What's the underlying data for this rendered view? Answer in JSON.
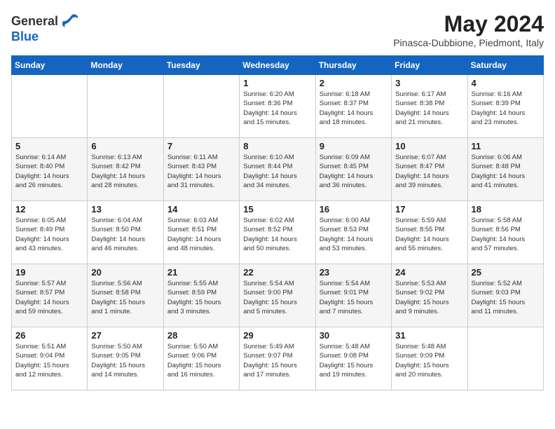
{
  "logo": {
    "general": "General",
    "blue": "Blue"
  },
  "title": "May 2024",
  "subtitle": "Pinasca-Dubbione, Piedmont, Italy",
  "days_of_week": [
    "Sunday",
    "Monday",
    "Tuesday",
    "Wednesday",
    "Thursday",
    "Friday",
    "Saturday"
  ],
  "weeks": [
    [
      {
        "day": "",
        "info": ""
      },
      {
        "day": "",
        "info": ""
      },
      {
        "day": "",
        "info": ""
      },
      {
        "day": "1",
        "info": "Sunrise: 6:20 AM\nSunset: 8:36 PM\nDaylight: 14 hours\nand 15 minutes."
      },
      {
        "day": "2",
        "info": "Sunrise: 6:18 AM\nSunset: 8:37 PM\nDaylight: 14 hours\nand 18 minutes."
      },
      {
        "day": "3",
        "info": "Sunrise: 6:17 AM\nSunset: 8:38 PM\nDaylight: 14 hours\nand 21 minutes."
      },
      {
        "day": "4",
        "info": "Sunrise: 6:16 AM\nSunset: 8:39 PM\nDaylight: 14 hours\nand 23 minutes."
      }
    ],
    [
      {
        "day": "5",
        "info": "Sunrise: 6:14 AM\nSunset: 8:40 PM\nDaylight: 14 hours\nand 26 minutes."
      },
      {
        "day": "6",
        "info": "Sunrise: 6:13 AM\nSunset: 8:42 PM\nDaylight: 14 hours\nand 28 minutes."
      },
      {
        "day": "7",
        "info": "Sunrise: 6:11 AM\nSunset: 8:43 PM\nDaylight: 14 hours\nand 31 minutes."
      },
      {
        "day": "8",
        "info": "Sunrise: 6:10 AM\nSunset: 8:44 PM\nDaylight: 14 hours\nand 34 minutes."
      },
      {
        "day": "9",
        "info": "Sunrise: 6:09 AM\nSunset: 8:45 PM\nDaylight: 14 hours\nand 36 minutes."
      },
      {
        "day": "10",
        "info": "Sunrise: 6:07 AM\nSunset: 8:47 PM\nDaylight: 14 hours\nand 39 minutes."
      },
      {
        "day": "11",
        "info": "Sunrise: 6:06 AM\nSunset: 8:48 PM\nDaylight: 14 hours\nand 41 minutes."
      }
    ],
    [
      {
        "day": "12",
        "info": "Sunrise: 6:05 AM\nSunset: 8:49 PM\nDaylight: 14 hours\nand 43 minutes."
      },
      {
        "day": "13",
        "info": "Sunrise: 6:04 AM\nSunset: 8:50 PM\nDaylight: 14 hours\nand 46 minutes."
      },
      {
        "day": "14",
        "info": "Sunrise: 6:03 AM\nSunset: 8:51 PM\nDaylight: 14 hours\nand 48 minutes."
      },
      {
        "day": "15",
        "info": "Sunrise: 6:02 AM\nSunset: 8:52 PM\nDaylight: 14 hours\nand 50 minutes."
      },
      {
        "day": "16",
        "info": "Sunrise: 6:00 AM\nSunset: 8:53 PM\nDaylight: 14 hours\nand 53 minutes."
      },
      {
        "day": "17",
        "info": "Sunrise: 5:59 AM\nSunset: 8:55 PM\nDaylight: 14 hours\nand 55 minutes."
      },
      {
        "day": "18",
        "info": "Sunrise: 5:58 AM\nSunset: 8:56 PM\nDaylight: 14 hours\nand 57 minutes."
      }
    ],
    [
      {
        "day": "19",
        "info": "Sunrise: 5:57 AM\nSunset: 8:57 PM\nDaylight: 14 hours\nand 59 minutes."
      },
      {
        "day": "20",
        "info": "Sunrise: 5:56 AM\nSunset: 8:58 PM\nDaylight: 15 hours\nand 1 minute."
      },
      {
        "day": "21",
        "info": "Sunrise: 5:55 AM\nSunset: 8:59 PM\nDaylight: 15 hours\nand 3 minutes."
      },
      {
        "day": "22",
        "info": "Sunrise: 5:54 AM\nSunset: 9:00 PM\nDaylight: 15 hours\nand 5 minutes."
      },
      {
        "day": "23",
        "info": "Sunrise: 5:54 AM\nSunset: 9:01 PM\nDaylight: 15 hours\nand 7 minutes."
      },
      {
        "day": "24",
        "info": "Sunrise: 5:53 AM\nSunset: 9:02 PM\nDaylight: 15 hours\nand 9 minutes."
      },
      {
        "day": "25",
        "info": "Sunrise: 5:52 AM\nSunset: 9:03 PM\nDaylight: 15 hours\nand 11 minutes."
      }
    ],
    [
      {
        "day": "26",
        "info": "Sunrise: 5:51 AM\nSunset: 9:04 PM\nDaylight: 15 hours\nand 12 minutes."
      },
      {
        "day": "27",
        "info": "Sunrise: 5:50 AM\nSunset: 9:05 PM\nDaylight: 15 hours\nand 14 minutes."
      },
      {
        "day": "28",
        "info": "Sunrise: 5:50 AM\nSunset: 9:06 PM\nDaylight: 15 hours\nand 16 minutes."
      },
      {
        "day": "29",
        "info": "Sunrise: 5:49 AM\nSunset: 9:07 PM\nDaylight: 15 hours\nand 17 minutes."
      },
      {
        "day": "30",
        "info": "Sunrise: 5:48 AM\nSunset: 9:08 PM\nDaylight: 15 hours\nand 19 minutes."
      },
      {
        "day": "31",
        "info": "Sunrise: 5:48 AM\nSunset: 9:09 PM\nDaylight: 15 hours\nand 20 minutes."
      },
      {
        "day": "",
        "info": ""
      }
    ]
  ]
}
